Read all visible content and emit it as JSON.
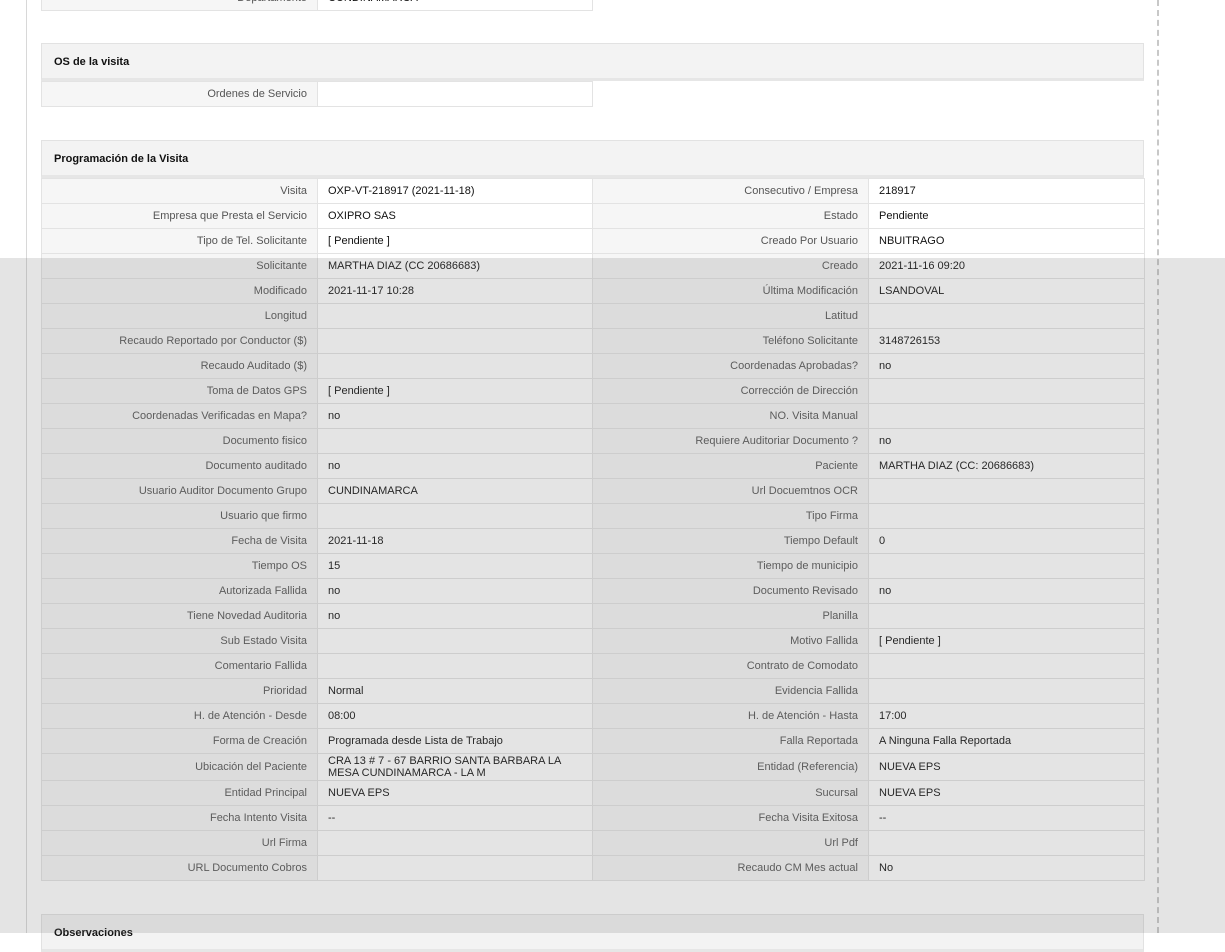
{
  "top_row": {
    "label": "Departamento",
    "value": "CUNDINAMARCA"
  },
  "os_section": {
    "title": "OS de la visita",
    "rows": [
      {
        "label": "Ordenes de Servicio",
        "value": ""
      }
    ]
  },
  "programacion": {
    "title": "Programación de la Visita",
    "rows": [
      {
        "l1": "Visita",
        "v1": "OXP-VT-218917 (2021-11-18)",
        "l2": "Consecutivo / Empresa",
        "v2": "218917"
      },
      {
        "l1": "Empresa que Presta el Servicio",
        "v1": "OXIPRO SAS",
        "l2": "Estado",
        "v2": "Pendiente"
      },
      {
        "l1": "Tipo de Tel. Solicitante",
        "v1": "[ Pendiente ]",
        "l2": "Creado Por Usuario",
        "v2": "NBUITRAGO"
      },
      {
        "l1": "Solicitante",
        "v1": "MARTHA DIAZ (CC 20686683)",
        "l2": "Creado",
        "v2": "2021-11-16 09:20"
      },
      {
        "l1": "Modificado",
        "v1": "2021-11-17 10:28",
        "l2": "Última Modificación",
        "v2": " LSANDOVAL"
      },
      {
        "l1": "Longitud",
        "v1": "",
        "l2": "Latitud",
        "v2": ""
      },
      {
        "l1": "Recaudo Reportado por Conductor ($)",
        "v1": "",
        "l2": "Teléfono Solicitante",
        "v2": "3148726153"
      },
      {
        "l1": "Recaudo Auditado ($)",
        "v1": "",
        "l2": "Coordenadas Aprobadas?",
        "v2": " no"
      },
      {
        "l1": "Toma de Datos GPS",
        "v1": "[ Pendiente ]",
        "l2": "Corrección de Dirección",
        "v2": ""
      },
      {
        "l1": "Coordenadas Verificadas en Mapa?",
        "v1": " no",
        "l2": "NO. Visita Manual",
        "v2": ""
      },
      {
        "l1": "Documento fisico",
        "v1": "",
        "l2": "Requiere Auditoriar Documento ?",
        "v2": " no"
      },
      {
        "l1": "Documento auditado",
        "v1": " no",
        "l2": "Paciente",
        "v2": "MARTHA DIAZ (CC: 20686683)"
      },
      {
        "l1": "Usuario Auditor Documento Grupo",
        "v1": "CUNDINAMARCA",
        "l2": "Url Docuemtnos OCR",
        "v2": ""
      },
      {
        "l1": "Usuario que firmo",
        "v1": "",
        "l2": "Tipo Firma",
        "v2": ""
      },
      {
        "l1": "Fecha de Visita",
        "v1": " 2021-11-18",
        "l2": "Tiempo Default",
        "v2": "0"
      },
      {
        "l1": "Tiempo OS",
        "v1": "15",
        "l2": "Tiempo de municipio",
        "v2": ""
      },
      {
        "l1": "Autorizada Fallida",
        "v1": " no",
        "l2": "Documento Revisado",
        "v2": " no"
      },
      {
        "l1": "Tiene Novedad Auditoria",
        "v1": " no",
        "l2": "Planilla",
        "v2": ""
      },
      {
        "l1": "Sub Estado Visita",
        "v1": "",
        "l2": "Motivo Fallida",
        "v2": "[ Pendiente ]"
      },
      {
        "l1": "Comentario Fallida",
        "v1": "",
        "l2": "Contrato de Comodato",
        "v2": ""
      },
      {
        "l1": "Prioridad",
        "v1": "Normal",
        "l2": "Evidencia Fallida",
        "v2": ""
      },
      {
        "l1": "H. de Atención - Desde",
        "v1": "08:00",
        "l2": "H. de Atención - Hasta",
        "v2": "17:00"
      },
      {
        "l1": "Forma de Creación",
        "v1": "Programada desde Lista de Trabajo",
        "l2": "Falla Reportada",
        "v2": "A Ninguna Falla Reportada"
      },
      {
        "l1": "Ubicación del Paciente",
        "v1": "CRA 13 # 7 - 67 BARRIO SANTA BARBARA LA MESA CUNDINAMARCA - LA M",
        "l2": "Entidad (Referencia)",
        "v2": "NUEVA EPS"
      },
      {
        "l1": "Entidad Principal",
        "v1": "NUEVA EPS",
        "l2": "Sucursal",
        "v2": "NUEVA EPS"
      },
      {
        "l1": "Fecha Intento Visita",
        "v1": " --",
        "l2": "Fecha Visita Exitosa",
        "v2": " --"
      },
      {
        "l1": "Url Firma",
        "v1": "",
        "l2": "Url Pdf",
        "v2": ""
      },
      {
        "l1": "URL Documento Cobros",
        "v1": "",
        "l2": "Recaudo CM Mes actual",
        "v2": "No"
      }
    ]
  },
  "observaciones": {
    "title": "Observaciones"
  }
}
